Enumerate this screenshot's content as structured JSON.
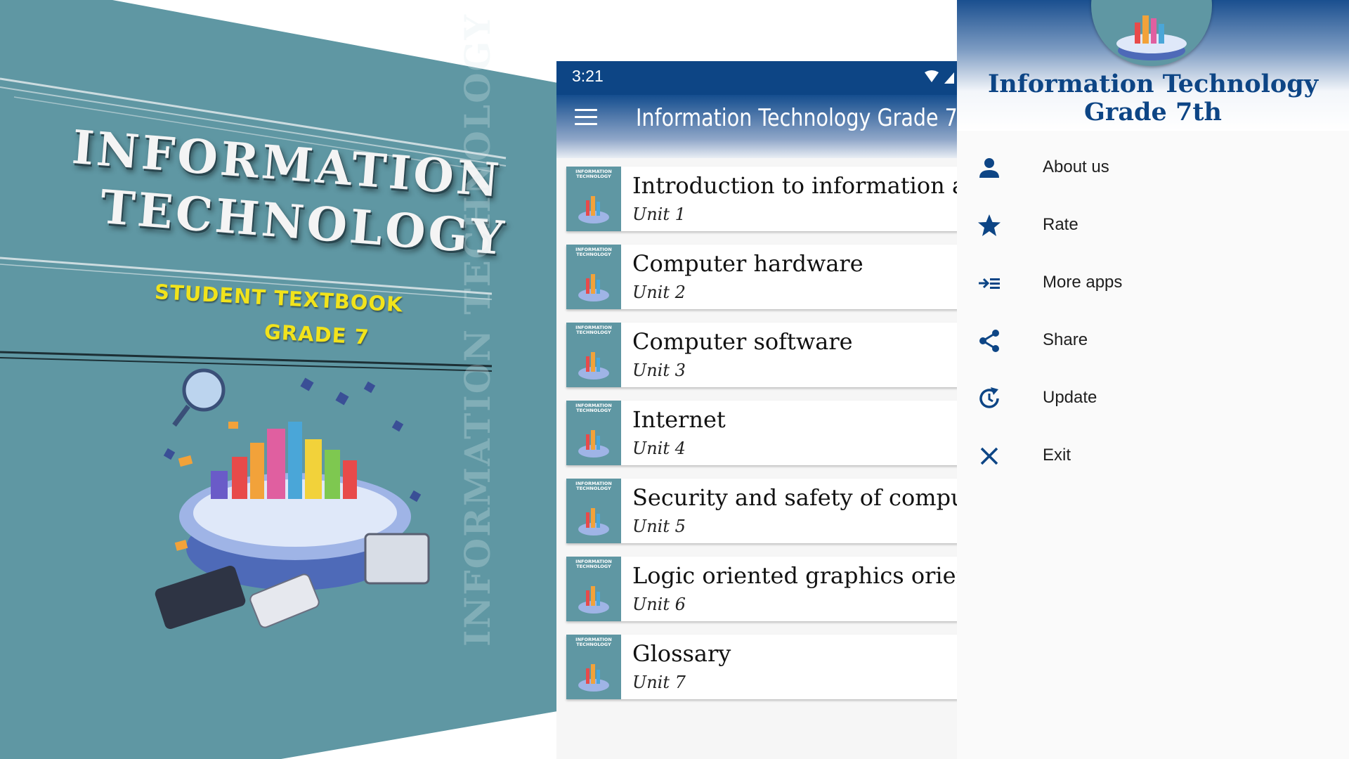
{
  "cover": {
    "title_line1": "INFORMATION",
    "title_line2": "TECHNOLOGY",
    "subtitle": "STUDENT TEXTBOOK",
    "grade": "GRADE 7",
    "spine_text": "INFORMATION TECHNOLOGY",
    "colors": {
      "background": "#5f97a3",
      "title": "#f4f4f4",
      "subtitle": "#f1e31c"
    }
  },
  "phone": {
    "status_bar": {
      "time": "3:21"
    },
    "app_bar": {
      "title": "Information Technology Grade 7",
      "menu_icon": "hamburger-menu-icon"
    },
    "thumb": {
      "line1": "INFORMATION",
      "line2": "TECHNOLOGY"
    },
    "units": [
      {
        "title": "Introduction to information and",
        "subtitle": "Unit 1"
      },
      {
        "title": "Computer hardware",
        "subtitle": "Unit 2"
      },
      {
        "title": "Computer software",
        "subtitle": "Unit 3"
      },
      {
        "title": "Internet",
        "subtitle": "Unit 4"
      },
      {
        "title": "Security and safety of computer",
        "subtitle": "Unit 5"
      },
      {
        "title": "Logic oriented graphics oriented",
        "subtitle": "Unit 6"
      },
      {
        "title": "Glossary",
        "subtitle": "Unit 7"
      }
    ],
    "colors": {
      "primary": "#0d4585"
    }
  },
  "drawer": {
    "title": "Information Technology Grade 7th",
    "items": [
      {
        "label": "About us",
        "icon": "person-icon"
      },
      {
        "label": "Rate",
        "icon": "star-icon"
      },
      {
        "label": "More apps",
        "icon": "more-apps-icon"
      },
      {
        "label": "Share",
        "icon": "share-icon"
      },
      {
        "label": "Update",
        "icon": "update-icon"
      },
      {
        "label": "Exit",
        "icon": "close-icon"
      }
    ],
    "colors": {
      "accent": "#0d4585"
    }
  }
}
